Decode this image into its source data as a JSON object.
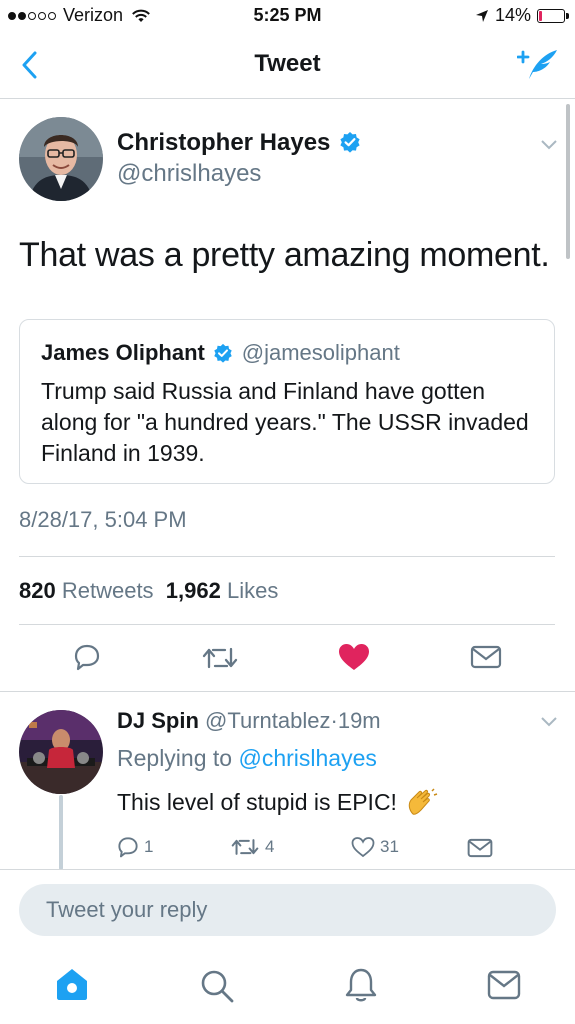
{
  "status_bar": {
    "carrier": "Verizon",
    "time": "5:25 PM",
    "battery": "14%",
    "battery_level": 0.14,
    "battery_color": "#e0245e"
  },
  "header": {
    "title": "Tweet",
    "back_icon": "chevron-left-icon",
    "compose_icon": "compose-tweet-icon"
  },
  "tweet": {
    "author_name": "Christopher Hayes",
    "author_handle": "@chrislhayes",
    "text": "That was a pretty amazing moment.",
    "quote": {
      "author_name": "James Oliphant",
      "author_handle": "@jamesoliphant",
      "text": "Trump said Russia and Finland have gotten along for \"a hundred years.\" The USSR invaded Finland in 1939."
    },
    "timestamp": "8/28/17, 5:04 PM",
    "retweet_count": "820",
    "retweet_label": "Retweets",
    "like_count": "1,962",
    "like_label": "Likes",
    "liked": true
  },
  "reply": {
    "author_name": "DJ Spin",
    "author_handle": "@Turntablez",
    "separator": "·",
    "time_ago": "19m",
    "replying_to_label": "Replying to",
    "replying_to_handle": "@chrislhayes",
    "text": "This level of stupid is EPIC!",
    "reply_count": "1",
    "retweet_count": "4",
    "like_count": "31"
  },
  "compose": {
    "placeholder": "Tweet your reply"
  },
  "tab_bar": [
    "home-icon",
    "search-icon",
    "notifications-icon",
    "messages-icon"
  ],
  "colors": {
    "accent": "#1da1f2",
    "like": "#e0245e",
    "muted": "#657786"
  }
}
